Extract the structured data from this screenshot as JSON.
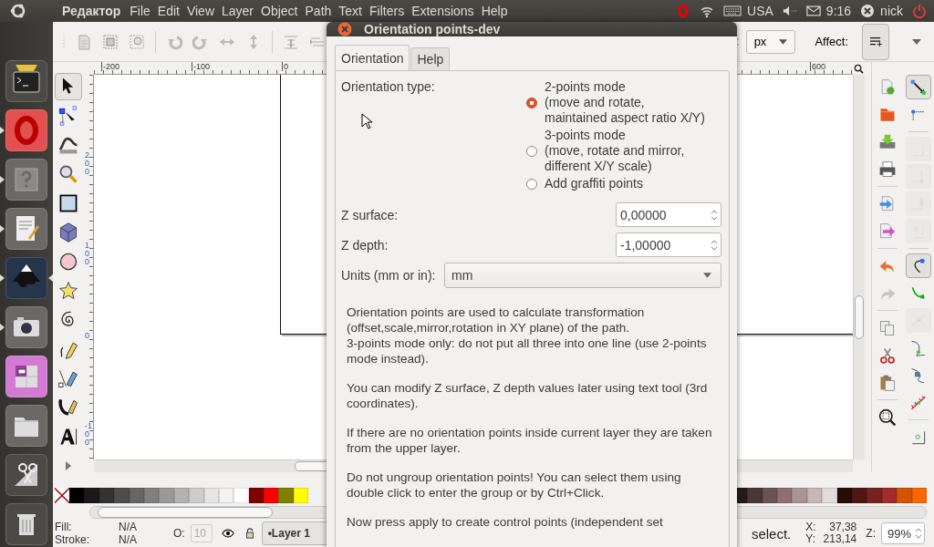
{
  "top_panel": {
    "app_title": "Редактор",
    "menus": [
      "File",
      "Edit",
      "View",
      "Layer",
      "Object",
      "Path",
      "Text",
      "Filters",
      "Extensions",
      "Help"
    ],
    "keyboard_layout": "USA",
    "clock": "9:16",
    "user": "nick"
  },
  "launcher": [
    {
      "running": false,
      "focused": false
    },
    {
      "running": true,
      "focused": false
    },
    {
      "running": true,
      "focused": false
    },
    {
      "running": true,
      "focused": false
    },
    {
      "running": true,
      "focused": true
    },
    {
      "running": true,
      "focused": false
    },
    {
      "running": false,
      "focused": false
    },
    {
      "running": false,
      "focused": false
    },
    {
      "running": false,
      "focused": false
    },
    {
      "running": false,
      "focused": false
    }
  ],
  "toolbar": {
    "unit": "px",
    "affect_label": "Affect:"
  },
  "toolbox": [
    {
      "selected": true
    },
    {
      "selected": false
    },
    {
      "selected": false
    },
    {
      "selected": false
    },
    {
      "selected": false
    },
    {
      "selected": false
    },
    {
      "selected": false
    },
    {
      "selected": false
    },
    {
      "selected": false
    },
    {
      "selected": false
    },
    {
      "selected": false
    },
    {
      "selected": false
    },
    {
      "selected": false
    }
  ],
  "ruler_top": {
    "labels": [
      "-200",
      "-100",
      "0"
    ],
    "far_labels": [
      "600"
    ]
  },
  "ruler_left": {
    "labels": [
      "200",
      "100",
      "0",
      "-100"
    ]
  },
  "commands": [
    {
      "disabled": false
    },
    {
      "disabled": false
    },
    {
      "disabled": false
    },
    {
      "disabled": false
    },
    {
      "disabled": false
    },
    {
      "disabled": false
    },
    {
      "disabled": false
    },
    {
      "disabled": true
    },
    {
      "disabled": false
    },
    {
      "disabled": false
    },
    {
      "disabled": false
    },
    {
      "disabled": false
    }
  ],
  "snap_buttons": [
    {
      "pressed": true,
      "disabled": false
    },
    {
      "pressed": false,
      "disabled": false
    },
    {
      "pressed": false,
      "disabled": true
    },
    {
      "pressed": false,
      "disabled": true
    },
    {
      "pressed": false,
      "disabled": true
    },
    {
      "pressed": false,
      "disabled": true
    },
    {
      "pressed": true,
      "disabled": false
    },
    {
      "pressed": false,
      "disabled": false
    },
    {
      "pressed": false,
      "disabled": true
    },
    {
      "pressed": false,
      "disabled": false
    },
    {
      "pressed": false,
      "disabled": false
    },
    {
      "pressed": false,
      "disabled": false
    },
    {
      "pressed": false,
      "disabled": false
    }
  ],
  "palette": {
    "left_swatches": [
      {
        "color": "#000000"
      },
      {
        "color": "#1a1a1a"
      },
      {
        "color": "#333333"
      },
      {
        "color": "#4d4d4d"
      },
      {
        "color": "#666666"
      },
      {
        "color": "#808080"
      },
      {
        "color": "#999999"
      },
      {
        "color": "#b3b3b3"
      },
      {
        "color": "#cccccc"
      },
      {
        "color": "#e6e6e6"
      },
      {
        "color": "#f2f2f2"
      },
      {
        "color": "#ffffff"
      },
      {
        "color": "#800000"
      },
      {
        "color": "#ff0000"
      },
      {
        "color": "#808000"
      },
      {
        "color": "#ffff00"
      }
    ],
    "right_swatches": [
      {
        "color": "#241c1c"
      },
      {
        "color": "#483737"
      },
      {
        "color": "#6c5353"
      },
      {
        "color": "#916f6f"
      },
      {
        "color": "#ac9393"
      },
      {
        "color": "#c8b7b7"
      },
      {
        "color": "#e3dbdb"
      },
      {
        "color": "#280b0b"
      },
      {
        "color": "#501616"
      },
      {
        "color": "#782121"
      },
      {
        "color": "#a02c2c"
      },
      {
        "color": "#d45500"
      },
      {
        "color": "#ff6600"
      }
    ]
  },
  "status_bar": {
    "fill_label": "Fill:",
    "fill_value": "N/A",
    "stroke_label": "Stroke:",
    "stroke_value": "N/A",
    "opacity_label": "O:",
    "opacity_value": "10",
    "layer": "•Layer 1",
    "message": "select.",
    "x_label": "X:",
    "x_value": "37,38",
    "y_label": "Y:",
    "y_value": "213,14",
    "zoom_label": "Z:",
    "zoom_value": "99%"
  },
  "dialog": {
    "title": "Orientation points-dev",
    "tabs": [
      {
        "label": "Orientation",
        "selected": true
      },
      {
        "label": "Help",
        "selected": false
      }
    ],
    "orientation_label": "Orientation type:",
    "options": [
      {
        "label": "2-points mode\n(move and rotate,\nmaintained aspect ratio X/Y)",
        "selected": true
      },
      {
        "label": "3-points mode\n(move, rotate and mirror,\ndifferent X/Y scale)",
        "selected": false
      },
      {
        "label": "Add graffiti points",
        "selected": false
      }
    ],
    "z_surface": {
      "label": "Z surface:",
      "value": "0,00000"
    },
    "z_depth": {
      "label": "Z depth:",
      "value": "-1,00000"
    },
    "units": {
      "label": "Units (mm or in):",
      "value": "mm"
    },
    "help_paragraphs": [
      "Orientation points are used to calculate transformation (offset,scale,mirror,rotation in XY plane) of the path.\n3-points mode only: do not put all three into one line (use 2-points mode instead).",
      "You can modify Z surface, Z depth values later using text tool (3rd coordinates).",
      "If there are no orientation points inside current layer they are taken from the upper layer.",
      "Do not ungroup orientation points! You can select them using double click to enter the group or by Ctrl+Click.",
      "Now press apply to create control points (independent set"
    ]
  }
}
